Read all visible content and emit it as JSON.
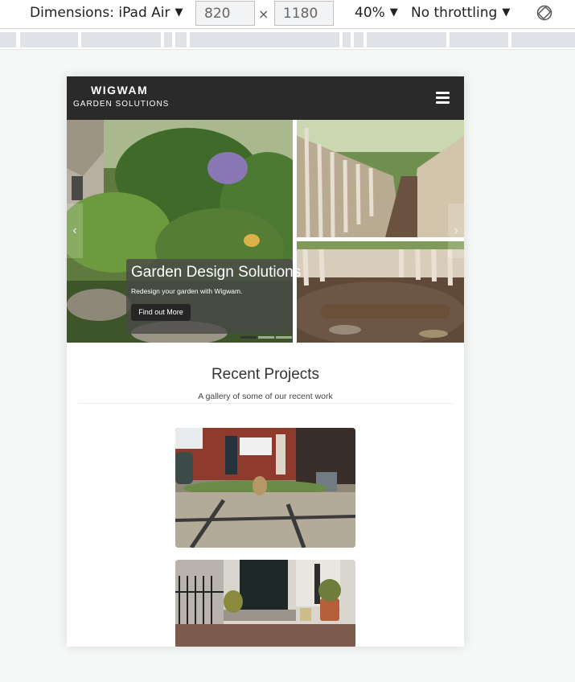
{
  "devtools": {
    "dimensions_label": "Dimensions: iPad Air",
    "width": "820",
    "height": "1180",
    "times": "×",
    "zoom": "40%",
    "throttle": "No throttling",
    "caret": "▼"
  },
  "site": {
    "brand_line1": "WIGWAM",
    "brand_line2": "GARDEN SOLUTIONS",
    "hero": {
      "caption_title": "Garden Design Solutions",
      "caption_text": "Redesign your garden with Wigwam.",
      "cta_label": "Find out More",
      "prev_symbol": "‹",
      "next_symbol": "›"
    },
    "projects": {
      "title": "Recent Projects",
      "subtitle": "A gallery of some of our recent work"
    }
  },
  "colors": {
    "navbar": "#2a2a2a",
    "page_background": "#f6f8f7"
  }
}
